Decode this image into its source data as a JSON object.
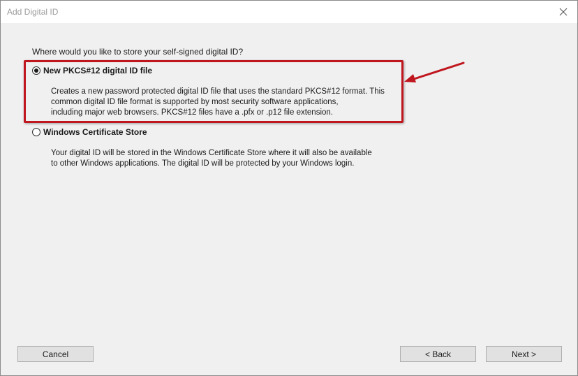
{
  "window": {
    "title": "Add Digital ID"
  },
  "prompt": {
    "question": "Where would you like to store your self-signed digital ID?"
  },
  "options": [
    {
      "label": "New PKCS#12 digital ID file",
      "selected": true,
      "description": [
        "Creates a new password protected digital ID file that uses the standard PKCS#12 format. This",
        "common digital ID file format is supported by most security software applications,",
        "including major web browsers. PKCS#12 files have a .pfx or .p12 file extension."
      ]
    },
    {
      "label": "Windows Certificate Store",
      "selected": false,
      "description": [
        "Your digital ID will be stored in the Windows Certificate Store where it will also be available",
        "to other Windows applications. The digital ID will be protected by your Windows login."
      ]
    }
  ],
  "buttons": {
    "cancel": "Cancel",
    "back": "< Back",
    "next": "Next >"
  },
  "colors": {
    "highlight": "#c0161e",
    "dialog_background": "#f0f0f0",
    "titlebar_background": "#ffffff"
  },
  "icons": {
    "close": "close-icon",
    "arrow": "red-arrow-annotation"
  }
}
